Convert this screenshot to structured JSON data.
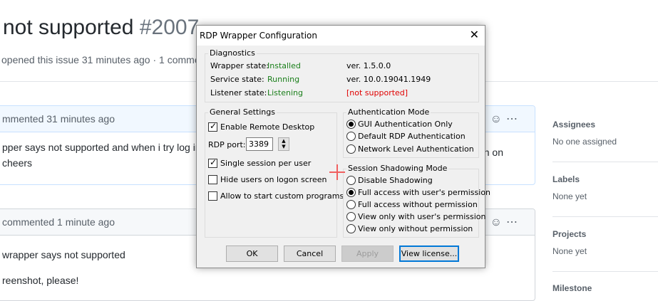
{
  "issue": {
    "title": "not supported",
    "number": "#2007",
    "meta": "opened this issue 31 minutes ago · 1 comment"
  },
  "comments": [
    {
      "header": "mmented 31 minutes ago",
      "lines": [
        "pper says not supported and when i try log in",
        "cheers"
      ],
      "tail": "n on"
    },
    {
      "header": "commented 1 minute ago",
      "lines": [
        "wrapper says not supported",
        "reenshot, please!"
      ]
    }
  ],
  "sidebar": {
    "assignees_title": "Assignees",
    "assignees_value": "No one assigned",
    "labels_title": "Labels",
    "labels_value": "None yet",
    "projects_title": "Projects",
    "projects_value": "None yet",
    "milestone_title": "Milestone"
  },
  "dialog": {
    "title": "RDP Wrapper Configuration",
    "close": "✕",
    "diagnostics": {
      "label": "Diagnostics",
      "wrapper_label": "Wrapper state:",
      "wrapper_value": "Installed",
      "wrapper_ver": "ver.  1.5.0.0",
      "service_label": "Service state:",
      "service_value": "Running",
      "service_ver": "ver.  10.0.19041.1949",
      "listener_label": "Listener state:",
      "listener_value": "Listening",
      "listener_ver": "[not supported]"
    },
    "general": {
      "label": "General Settings",
      "enable_rdp": "Enable Remote Desktop",
      "rdp_port_label": "RDP port:",
      "rdp_port_value": "3389",
      "single_session": "Single session per user",
      "hide_users": "Hide users on logon screen",
      "custom_programs": "Allow to start custom programs"
    },
    "auth": {
      "label": "Authentication Mode",
      "opt1": "GUI Authentication Only",
      "opt2": "Default RDP Authentication",
      "opt3": "Network Level Authentication"
    },
    "shadow": {
      "label": "Session Shadowing Mode",
      "opt1": "Disable Shadowing",
      "opt2": "Full access with user's permission",
      "opt3": "Full access without permission",
      "opt4": "View only with user's permission",
      "opt5": "View only without permission"
    },
    "buttons": {
      "ok": "OK",
      "cancel": "Cancel",
      "apply": "Apply",
      "license": "View license..."
    },
    "colors": {
      "ok_state": "#1a7f1a",
      "error_state": "#e00000",
      "focus": "#0078d7"
    }
  }
}
